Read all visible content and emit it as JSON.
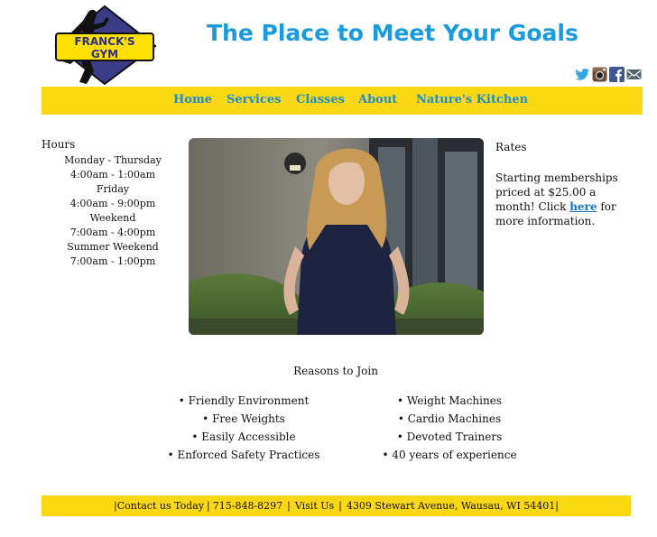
{
  "header": {
    "logo_text": "FRANCK'S GYM",
    "title": "The Place to Meet Your Goals"
  },
  "social": [
    "twitter-icon",
    "instagram-icon",
    "facebook-icon",
    "email-icon"
  ],
  "nav": [
    {
      "label": "Home"
    },
    {
      "label": "Services"
    },
    {
      "label": "Classes"
    },
    {
      "label": "About"
    },
    {
      "label": "Nature's Kitchen"
    }
  ],
  "hours": {
    "heading": "Hours",
    "lines": [
      "Monday - Thursday",
      "4:00am - 1:00am",
      "Friday",
      "4:00am - 9:00pm",
      "Weekend",
      "7:00am - 4:00pm",
      "Summer Weekend",
      "7:00am - 1:00pm"
    ]
  },
  "rates": {
    "heading": "Rates",
    "text_before": "Starting memberships priced at $25.00 a month! Click ",
    "link": "here",
    "text_after": " for more information."
  },
  "reasons": {
    "title": "Reasons to Join",
    "left": [
      "Friendly Environment",
      "Free Weights",
      "Easily Accessible",
      "Enforced Safety Practices"
    ],
    "right": [
      "Weight Machines",
      "Cardio Machines",
      "Devoted Trainers",
      "40 years of experience"
    ]
  },
  "footer": {
    "contact": "Contact us Today",
    "phone": "715-848-8297",
    "visit": "Visit Us",
    "address": "4309 Stewart Avenue, Wausau, WI 54401",
    "separator": "|"
  },
  "colors": {
    "accent": "#fcd713",
    "link": "#1d8fd1",
    "title": "#1a9be0"
  }
}
